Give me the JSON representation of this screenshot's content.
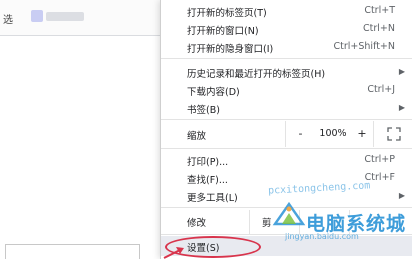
{
  "background_page": {
    "tab_text": "选"
  },
  "menu": {
    "items": [
      {
        "label": "打开新的标签页(T)",
        "shortcut": "Ctrl+T"
      },
      {
        "label": "打开新的窗口(N)",
        "shortcut": "Ctrl+N"
      },
      {
        "label": "打开新的隐身窗口(I)",
        "shortcut": "Ctrl+Shift+N"
      },
      {
        "label": "历史记录和最近打开的标签页(H)",
        "shortcut": ""
      },
      {
        "label": "下载内容(D)",
        "shortcut": "Ctrl+J"
      },
      {
        "label": "书签(B)",
        "shortcut": ""
      }
    ],
    "zoom": {
      "label": "缩放",
      "minus": "-",
      "value": "100%",
      "plus": "+"
    },
    "items2": [
      {
        "label": "打印(P)...",
        "shortcut": "Ctrl+P"
      },
      {
        "label": "查找(F)...",
        "shortcut": "Ctrl+F"
      },
      {
        "label": "更多工具(L)",
        "shortcut": ""
      }
    ],
    "edit": {
      "label": "修改",
      "cut": "剪"
    },
    "settings": {
      "label": "设置(S)"
    }
  },
  "watermark": {
    "text": "电脑系统城",
    "url_main": "pcxitongcheng.com",
    "url_small": "jingyan.baidu.com"
  },
  "colors": {
    "highlight_ring": "#d8344c",
    "watermark": "#2a93d6",
    "selected_row": "#e8eaf0"
  }
}
